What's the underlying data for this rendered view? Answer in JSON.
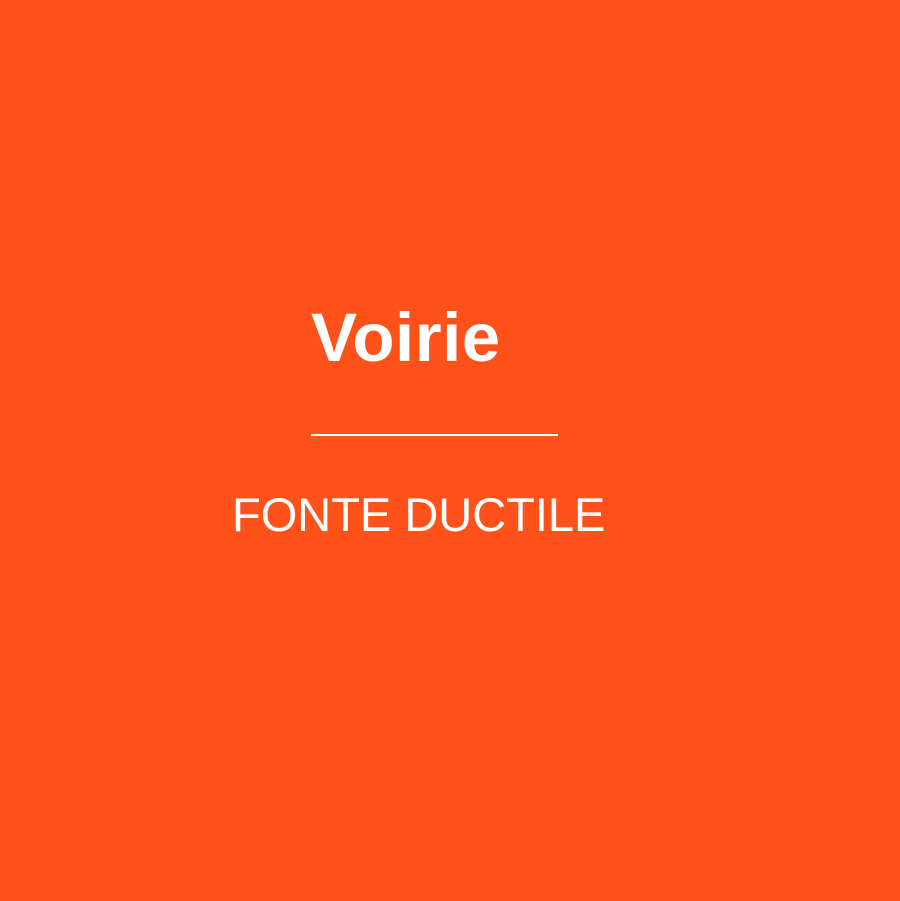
{
  "tile": {
    "title": "Voirie",
    "subtitle": "FONTE DUCTILE",
    "background_color": "#ff521b",
    "text_color": "#ffffff"
  }
}
